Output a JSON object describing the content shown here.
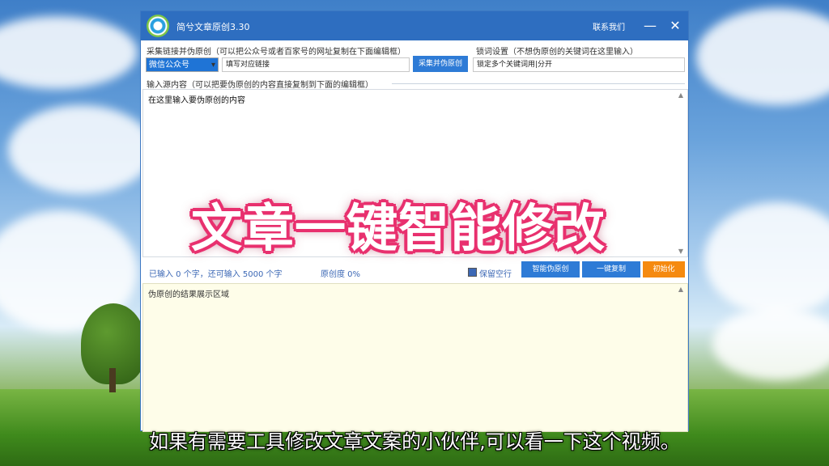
{
  "window": {
    "title": "简兮文章原创3.30",
    "contact_label": "联系我们",
    "minimize_glyph": "—",
    "close_glyph": "✕"
  },
  "collect": {
    "section_label": "采集链接并伪原创（可以把公众号或者百家号的网址复制在下面编辑框）",
    "source_selected": "微信公众号",
    "link_field_value": "填写对应链接",
    "collect_button": "采集并伪原创"
  },
  "lock": {
    "section_label": "锁词设置（不想伪原创的关键词在这里输入）",
    "field_value": "锁定多个关键词用|分开"
  },
  "input": {
    "section_label": "输入源内容（可以把要伪原创的内容直接复制到下面的编辑框）",
    "content": "在这里输入要伪原创的内容"
  },
  "status": {
    "count_text": "已输入 0 个字，还可输入 5000 个字",
    "originality": "原创度 0%",
    "checkbox_label": "保留空行",
    "btn_rewrite": "智能伪原创",
    "btn_copy": "一键复制",
    "btn_init": "初始化"
  },
  "result": {
    "content": "伪原创的结果展示区域"
  },
  "overlay": {
    "headline": "文章一键智能修改",
    "subtitle": "如果有需要工具修改文章文案的小伙伴,可以看一下这个视频。"
  },
  "colors": {
    "titlebar": "#2e6ec0",
    "accent_blue": "#3c68b5",
    "button_blue": "#2e7bd6",
    "button_orange": "#f58a10",
    "overlay_pink": "#e8316f",
    "result_bg": "#fefde9"
  }
}
